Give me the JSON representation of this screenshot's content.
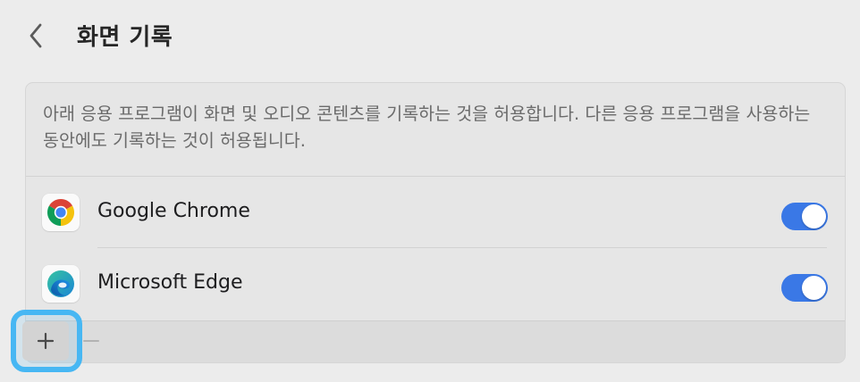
{
  "header": {
    "title": "화면 기록",
    "back_icon": "chevron-left-icon"
  },
  "panel": {
    "description": "아래 응용 프로그램이 화면 및 오디오 콘텐츠를 기록하는 것을 허용합니다. 다른 응용 프로그램을 사용하는 동안에도 기록하는 것이 허용됩니다.",
    "apps": [
      {
        "name": "Google Chrome",
        "icon": "chrome-icon",
        "enabled": true
      },
      {
        "name": "Microsoft Edge",
        "icon": "edge-icon",
        "enabled": true
      }
    ],
    "footer": {
      "add_label": "+",
      "remove_label": "−"
    }
  },
  "colors": {
    "toggle_on": "#3a78e6",
    "highlight_ring": "#47b7f3"
  }
}
